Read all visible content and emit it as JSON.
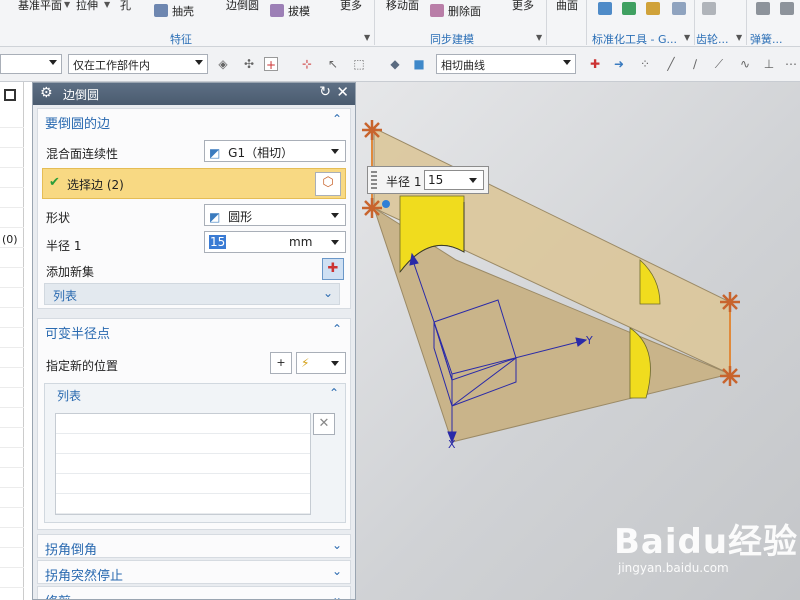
{
  "ribbon": {
    "items": {
      "datum_plane": "基准平面",
      "extrude": "拉伸",
      "hole": "孔",
      "shell": "抽壳",
      "edge_blend": "边倒圆",
      "draft": "拔模",
      "more1": "更多",
      "move_face": "移动面",
      "delete_face": "删除面",
      "more2": "更多",
      "surface": "曲面"
    },
    "groups": {
      "feature": "特征",
      "sync_modeling": "同步建模",
      "standard_tools": "标准化工具 - G...",
      "gear": "齿轮...",
      "spring": "弹簧..."
    }
  },
  "toolbar": {
    "filter_combo": "仅在工作部件内",
    "curve_rule_combo": "相切曲线"
  },
  "leftstrip": {
    "badge": "(0)"
  },
  "dialog": {
    "title": "边倒圆",
    "edges_section": {
      "title": "要倒圆的边",
      "continuity_label": "混合面连续性",
      "continuity_value": "G1（相切）",
      "select_edge": "选择边 (2)",
      "shape_label": "形状",
      "shape_value": "圆形",
      "radius_label": "半径 1",
      "radius_value": "15",
      "radius_unit": "mm",
      "add_set_label": "添加新集",
      "list_label": "列表"
    },
    "variable_section": {
      "title": "可变半径点",
      "new_location_label": "指定新的位置",
      "list_label": "列表"
    },
    "corner_setback": "拐角倒角",
    "corner_stop": "拐角突然停止",
    "trim": "修剪"
  },
  "viewport": {
    "radius_tag_label": "半径 1",
    "radius_tag_value": "15",
    "axis_x": "X",
    "axis_y": "Y",
    "accent_yellow": "#f0dc1e",
    "panel_tan": "#d9c391",
    "handle_orange": "#c8642d"
  },
  "watermark": {
    "main": "Baidu经验",
    "sub": "jingyan.baidu.com"
  }
}
